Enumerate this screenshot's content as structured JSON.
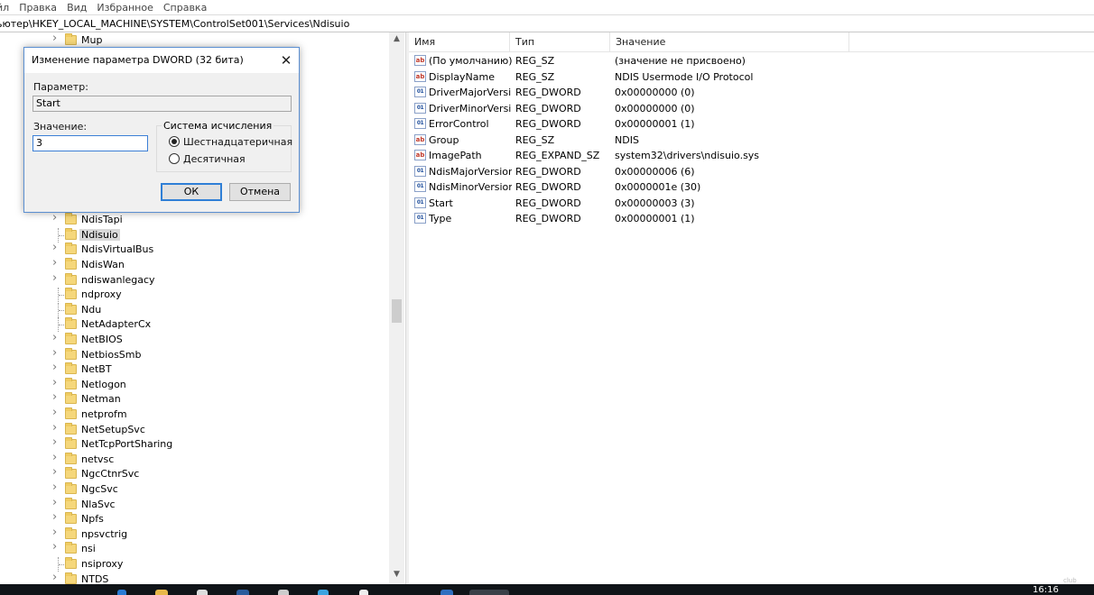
{
  "menu": [
    "йл",
    "Правка",
    "Вид",
    "Избранное",
    "Справка"
  ],
  "address": "ьютер\\HKEY_LOCAL_MACHINE\\SYSTEM\\ControlSet001\\Services\\Ndisuio",
  "tree": [
    {
      "label": "Mup",
      "expandable": true
    },
    {
      "label": "NdisTapi",
      "expandable": true
    },
    {
      "label": "Ndisuio",
      "expandable": false,
      "selected": true
    },
    {
      "label": "NdisVirtualBus",
      "expandable": true
    },
    {
      "label": "NdisWan",
      "expandable": true
    },
    {
      "label": "ndiswanlegacy",
      "expandable": true
    },
    {
      "label": "ndproxy",
      "expandable": false
    },
    {
      "label": "Ndu",
      "expandable": false
    },
    {
      "label": "NetAdapterCx",
      "expandable": false
    },
    {
      "label": "NetBIOS",
      "expandable": true
    },
    {
      "label": "NetbiosSmb",
      "expandable": true
    },
    {
      "label": "NetBT",
      "expandable": true
    },
    {
      "label": "Netlogon",
      "expandable": true
    },
    {
      "label": "Netman",
      "expandable": true
    },
    {
      "label": "netprofm",
      "expandable": true
    },
    {
      "label": "NetSetupSvc",
      "expandable": true
    },
    {
      "label": "NetTcpPortSharing",
      "expandable": true
    },
    {
      "label": "netvsc",
      "expandable": true
    },
    {
      "label": "NgcCtnrSvc",
      "expandable": true
    },
    {
      "label": "NgcSvc",
      "expandable": true
    },
    {
      "label": "NlaSvc",
      "expandable": true
    },
    {
      "label": "Npfs",
      "expandable": true
    },
    {
      "label": "npsvctrig",
      "expandable": true
    },
    {
      "label": "nsi",
      "expandable": true
    },
    {
      "label": "nsiproxy",
      "expandable": false
    },
    {
      "label": "NTDS",
      "expandable": true
    }
  ],
  "list": {
    "headers": [
      "Имя",
      "Тип",
      "Значение"
    ],
    "rows": [
      {
        "icon": "string-value-icon",
        "name": "(По умолчанию)",
        "type": "REG_SZ",
        "value": "(значение не присвоено)"
      },
      {
        "icon": "string-value-icon",
        "name": "DisplayName",
        "type": "REG_SZ",
        "value": "NDIS Usermode I/O Protocol"
      },
      {
        "icon": "binary-value-icon",
        "name": "DriverMajorVersi...",
        "type": "REG_DWORD",
        "value": "0x00000000 (0)"
      },
      {
        "icon": "binary-value-icon",
        "name": "DriverMinorVersi...",
        "type": "REG_DWORD",
        "value": "0x00000000 (0)"
      },
      {
        "icon": "binary-value-icon",
        "name": "ErrorControl",
        "type": "REG_DWORD",
        "value": "0x00000001 (1)"
      },
      {
        "icon": "string-value-icon",
        "name": "Group",
        "type": "REG_SZ",
        "value": "NDIS"
      },
      {
        "icon": "string-value-icon",
        "name": "ImagePath",
        "type": "REG_EXPAND_SZ",
        "value": "system32\\drivers\\ndisuio.sys"
      },
      {
        "icon": "binary-value-icon",
        "name": "NdisMajorVersion",
        "type": "REG_DWORD",
        "value": "0x00000006 (6)"
      },
      {
        "icon": "binary-value-icon",
        "name": "NdisMinorVersion",
        "type": "REG_DWORD",
        "value": "0x0000001e (30)"
      },
      {
        "icon": "binary-value-icon",
        "name": "Start",
        "type": "REG_DWORD",
        "value": "0x00000003 (3)"
      },
      {
        "icon": "binary-value-icon",
        "name": "Type",
        "type": "REG_DWORD",
        "value": "0x00000001 (1)"
      }
    ]
  },
  "dialog": {
    "title": "Изменение параметра DWORD (32 бита)",
    "param_label": "Параметр:",
    "param_value": "Start",
    "value_label": "Значение:",
    "value": "3",
    "base_label": "Система исчисления",
    "hex_label": "Шестнадцатеричная",
    "dec_label": "Десятичная",
    "selected_base": "hex",
    "ok_label": "ОК",
    "cancel_label": "Отмена"
  },
  "taskbar": {
    "clock": "16:16"
  },
  "watermark": "club"
}
